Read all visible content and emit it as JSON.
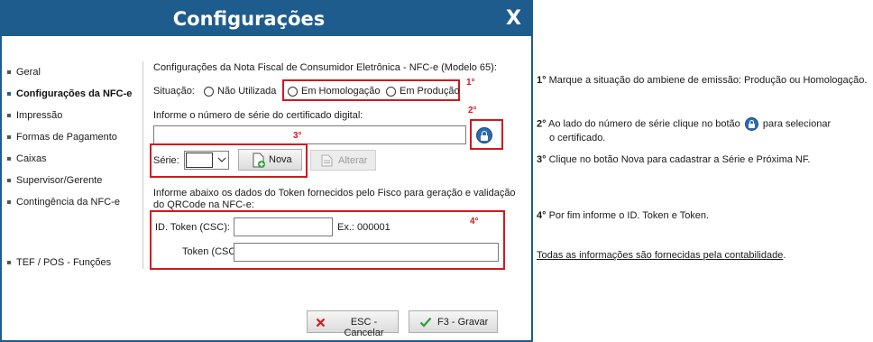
{
  "window": {
    "title": "Configurações",
    "close_label": "X"
  },
  "sidebar": {
    "items": [
      {
        "label": "Geral"
      },
      {
        "label": "Configurações da NFC-e",
        "active": true
      },
      {
        "label": "Impressão"
      },
      {
        "label": "Formas de Pagamento"
      },
      {
        "label": "Caixas"
      },
      {
        "label": "Supervisor/Gerente"
      },
      {
        "label": "Contingência da NFC-e"
      },
      {
        "label": "TEF / POS - Funções"
      }
    ]
  },
  "form": {
    "heading": "Configurações da Nota Fiscal de Consumidor Eletrônica - NFC-e (Modelo 65):",
    "situacao_label": "Situação:",
    "situacao_options": [
      "Não Utilizada",
      "Em Homologação",
      "Em Produção"
    ],
    "cert_label": "Informe o número de série do certificado digital:",
    "cert_value": "",
    "serie_label": "Série:",
    "serie_value": "",
    "nova_label": "Nova",
    "alterar_label": "Alterar",
    "token_info_line1": "Informe abaixo os dados do Token fornecidos pelo Fisco para geração e validação",
    "token_info_line2": "do QRCode na NFC-e:",
    "id_token_label": "ID. Token (CSC):",
    "id_token_value": "",
    "id_token_example": "Ex.: 000001",
    "token_label": "Token (CSC):",
    "token_value": ""
  },
  "annotations": {
    "n1": "1°",
    "n2": "2°",
    "n3": "3°",
    "n4": "4°"
  },
  "footer": {
    "cancel_label": "ESC - Cancelar",
    "save_label": "F3 - Gravar"
  },
  "notes": {
    "n1_num": "1°",
    "n1_text": " Marque a situação do ambiene de emissão: Produção ou Homologação.",
    "n2_num": "2°",
    "n2_text_a": " Ao lado do número de série clique no botão ",
    "n2_text_b": " para selecionar",
    "n2_text_c": "o certificado.",
    "n3_num": "3°",
    "n3_text": " Clique no botão Nova para cadastrar a Série e Próxima NF.",
    "n4_num": "4°",
    "n4_text": " Por fim informe o ID. Token e Token.",
    "footer_link": "Todas as informações são fornecidas pela contabilidade",
    "footer_dot": "."
  },
  "colors": {
    "titlebar": "#1e5c8e",
    "highlight": "#d4171e",
    "save_check": "#2e9e3a",
    "cancel_x": "#d4171e"
  }
}
